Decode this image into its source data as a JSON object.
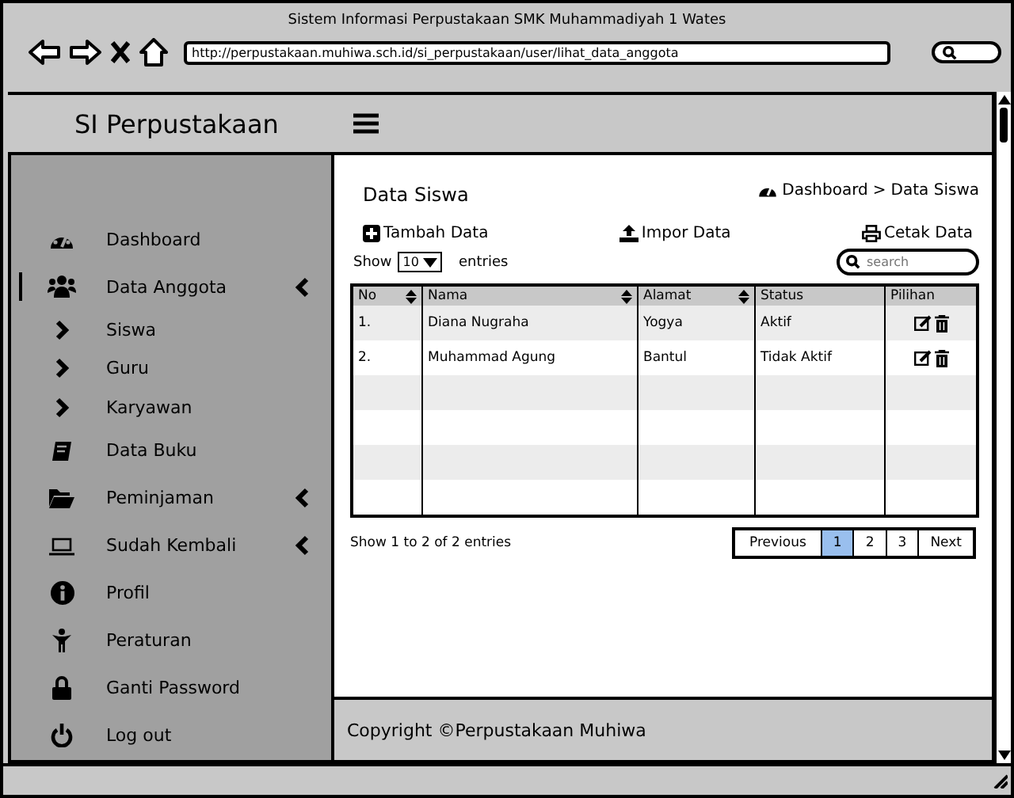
{
  "window": {
    "title": "Sistem Informasi Perpustakaan SMK Muhammadiyah 1 Wates",
    "url": "http://perpustakaan.muhiwa.sch.id/si_perpustakaan/user/lihat_data_anggota"
  },
  "header": {
    "brand": "SI Perpustakaan"
  },
  "sidebar": {
    "items": [
      {
        "label": "Dashboard",
        "selected": false,
        "expandable": false
      },
      {
        "label": "Data Anggota",
        "selected": true,
        "expandable": true,
        "children": [
          {
            "label": "Siswa"
          },
          {
            "label": "Guru"
          },
          {
            "label": "Karyawan"
          }
        ]
      },
      {
        "label": "Data Buku",
        "selected": false,
        "expandable": false
      },
      {
        "label": "Peminjaman",
        "selected": false,
        "expandable": true
      },
      {
        "label": "Sudah Kembali",
        "selected": false,
        "expandable": true
      },
      {
        "label": "Profil",
        "selected": false,
        "expandable": false
      },
      {
        "label": "Peraturan",
        "selected": false,
        "expandable": false
      },
      {
        "label": "Ganti Password",
        "selected": false,
        "expandable": false
      },
      {
        "label": "Log out",
        "selected": false,
        "expandable": false
      }
    ]
  },
  "content": {
    "title": "Data Siswa",
    "breadcrumb": [
      "Dashboard",
      "Data Siswa"
    ],
    "breadcrumb_separator": ">",
    "actions": [
      "Tambah Data",
      "Impor Data",
      "Cetak Data"
    ],
    "length": {
      "prefix": "Show",
      "value": "10",
      "suffix": "entries"
    },
    "search": {
      "placeholder": "search"
    },
    "table": {
      "columns": [
        {
          "label": "No",
          "sortable": true
        },
        {
          "label": "Nama",
          "sortable": true
        },
        {
          "label": "Alamat",
          "sortable": true
        },
        {
          "label": "Status",
          "sortable": false
        },
        {
          "label": "Pilihan",
          "sortable": false
        }
      ],
      "rows": [
        {
          "cells": [
            "1.",
            "Diana Nugraha",
            "Yogya",
            "Aktif"
          ]
        },
        {
          "cells": [
            "2.",
            "Muhammad Agung",
            "Bantul",
            "Tidak Aktif"
          ]
        }
      ]
    },
    "info": "Show 1 to 2 of 2 entries",
    "pagination": [
      {
        "label": "Previous",
        "selected": false
      },
      {
        "label": "1",
        "selected": true
      },
      {
        "label": "2",
        "selected": false
      },
      {
        "label": "3",
        "selected": false
      },
      {
        "label": "Next",
        "selected": false
      }
    ]
  },
  "footer": {
    "text": "Copyright ©Perpustakaan Muhiwa"
  }
}
